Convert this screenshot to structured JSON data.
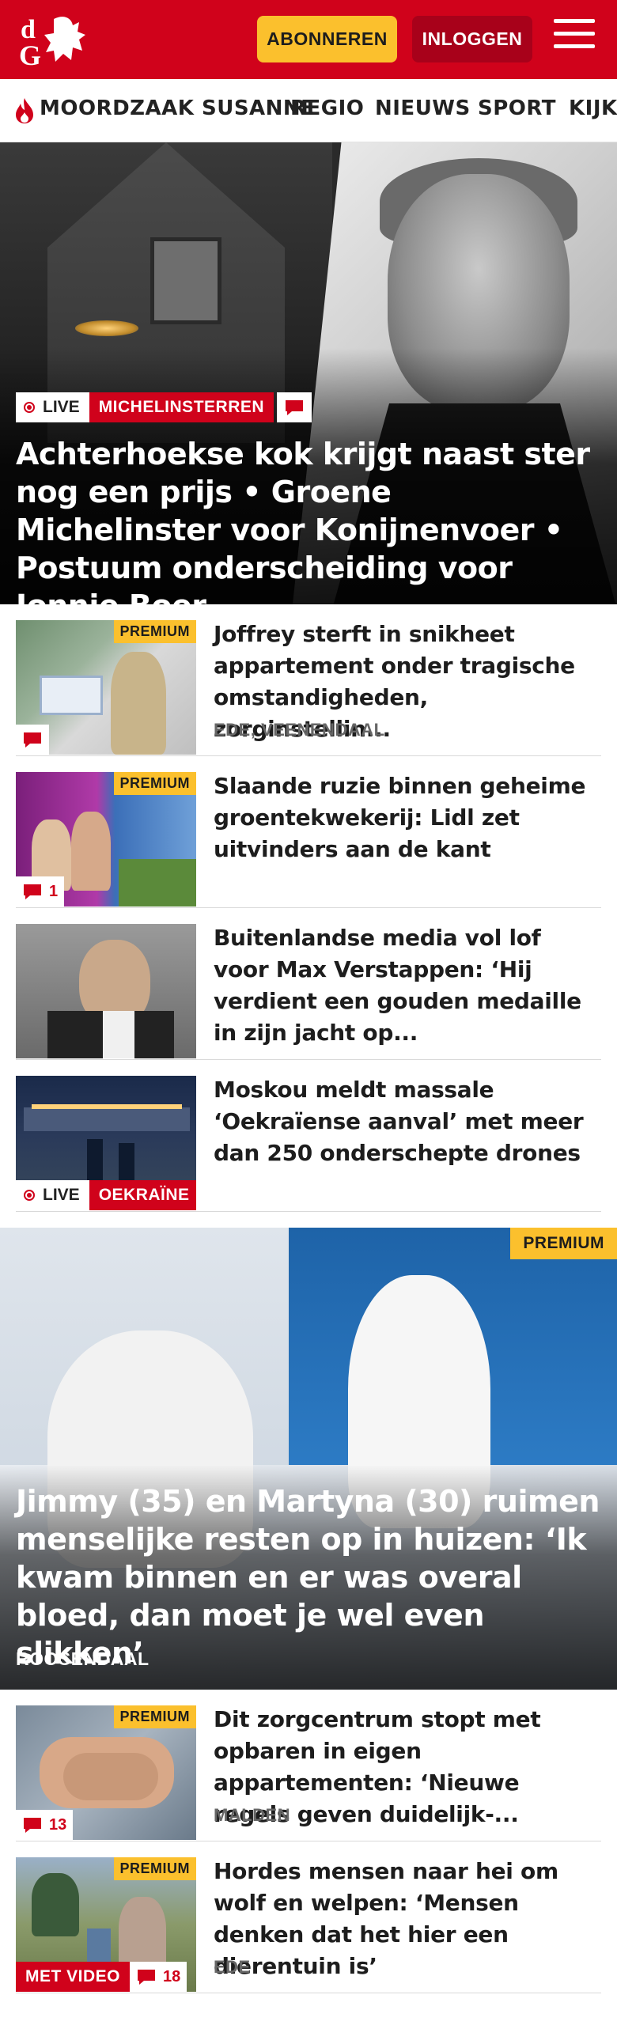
{
  "header": {
    "logo_text": "dG",
    "subscribe_label": "ABONNEREN",
    "login_label": "INLOGGEN",
    "brand_color": "#d0021b"
  },
  "nav": {
    "items": [
      {
        "label": "MOORDZAAK SUSANNE",
        "icon": "flame-icon"
      },
      {
        "label": "REGIO"
      },
      {
        "label": "NIEUWS"
      },
      {
        "label": "SPORT"
      },
      {
        "label": "KIJK"
      }
    ]
  },
  "hero": {
    "live_label": "LIVE",
    "topic_label": "MICHELINSTERREN",
    "title": "Achterhoekse kok krijgt naast ster nog een prijs • Groene Michelinster voor Konijnenvoer • Postuum onderscheiding voor Jonnie Boer"
  },
  "articles": [
    {
      "premium": "PREMIUM",
      "title": "Joffrey sterft in snikheet appartement onder tragische omstandigheden, zorginstellin...",
      "location": "EDE, VEENENDAAL",
      "comments": ""
    },
    {
      "premium": "PREMIUM",
      "title": "Slaande ruzie binnen geheime groentekwekerij: Lidl zet uitvinders aan de kant",
      "location": "",
      "comments": "1"
    },
    {
      "premium": "",
      "title": "Buitenlandse media vol lof voor Max Verstappen: ‘Hij verdient een gouden medaille in zijn jacht op...",
      "location": "",
      "comments": ""
    },
    {
      "premium": "",
      "title": "Moskou meldt massale ‘Oekraïense aanval’ met meer dan 250 onderschepte drones",
      "location": "",
      "live_label": "LIVE",
      "topic_label": "OEKRAÏNE"
    }
  ],
  "feature": {
    "premium": "PREMIUM",
    "title": "Jimmy (35) en Martyna (30) ruimen menselijke resten op in huizen: ‘Ik kwam binnen en er was overal bloed, dan moet je wel even slikken’",
    "location": "ROOSENDAAL"
  },
  "articles2": [
    {
      "premium": "PREMIUM",
      "title": "Dit zorgcentrum stopt met opbaren in eigen appartementen: ‘Nieuwe regels geven duidelijk-...",
      "location": "MALDEN",
      "comments": "13"
    },
    {
      "premium": "PREMIUM",
      "title": "Hordes mensen naar hei om wolf en welpen: ‘Mensen denken dat het hier een dierentuin is’",
      "location": "EDE",
      "video_label": "MET VIDEO",
      "comments": "18"
    }
  ]
}
